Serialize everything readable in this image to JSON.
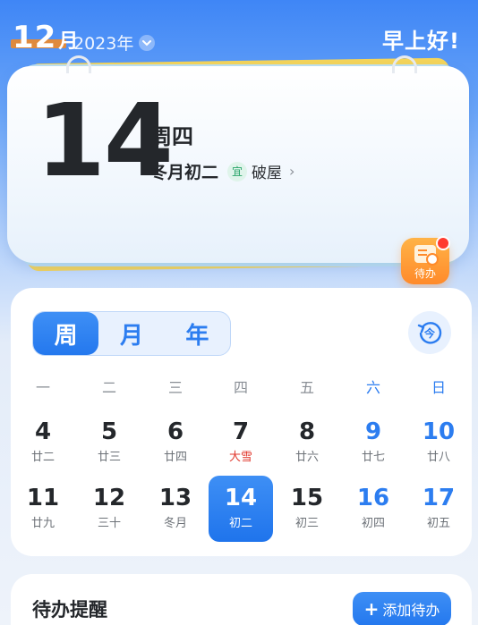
{
  "header": {
    "month": "12",
    "month_unit": "月",
    "year": "2023年",
    "greeting": "早上好!"
  },
  "daily": {
    "day": "14",
    "weekday": "周四",
    "lunar": "冬月初二",
    "yi_badge": "宜",
    "yi_item": "破屋",
    "chevron": "›"
  },
  "todo_fab": {
    "label": "待办"
  },
  "view_tabs": [
    {
      "label": "周",
      "active": true
    },
    {
      "label": "月",
      "active": false
    },
    {
      "label": "年",
      "active": false
    }
  ],
  "today_button": {
    "label": "今"
  },
  "week_headers": [
    "一",
    "二",
    "三",
    "四",
    "五",
    "六",
    "日"
  ],
  "week_rows": [
    [
      {
        "d": "4",
        "l": "廿二"
      },
      {
        "d": "5",
        "l": "廿三"
      },
      {
        "d": "6",
        "l": "廿四"
      },
      {
        "d": "7",
        "l": "大雪",
        "holiday": true
      },
      {
        "d": "8",
        "l": "廿六"
      },
      {
        "d": "9",
        "l": "廿七"
      },
      {
        "d": "10",
        "l": "廿八"
      }
    ],
    [
      {
        "d": "11",
        "l": "廿九"
      },
      {
        "d": "12",
        "l": "三十"
      },
      {
        "d": "13",
        "l": "冬月"
      },
      {
        "d": "14",
        "l": "初二",
        "selected": true
      },
      {
        "d": "15",
        "l": "初三"
      },
      {
        "d": "16",
        "l": "初四"
      },
      {
        "d": "17",
        "l": "初五"
      }
    ]
  ],
  "todo_section": {
    "title": "待办提醒",
    "add_label": "添加待办",
    "add_plus": "+"
  },
  "colors": {
    "accent": "#2478ee",
    "weekend": "#2c7df0",
    "holiday": "#e13a2f",
    "badge_red": "#ff3b30",
    "todo_orange": "#ff8a2a"
  }
}
